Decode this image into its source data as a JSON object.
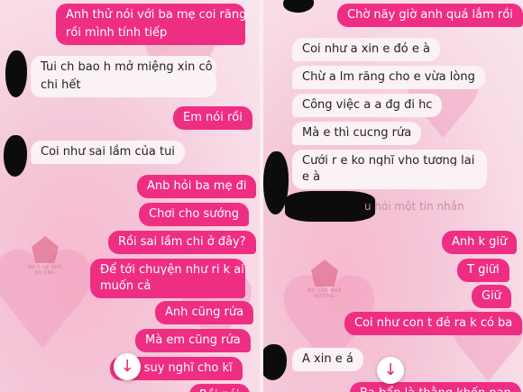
{
  "left": {
    "messages": [
      {
        "side": "out",
        "text": "Anh thử nói với ba mẹ coi răng"
      },
      {
        "side": "out",
        "text": "rồi mình tính tiếp"
      },
      {
        "side": "in",
        "text": "Tui ch bao h mở miệng xin cô"
      },
      {
        "side": "in",
        "text": "chi hết"
      },
      {
        "side": "out",
        "text": "Em nói rồi"
      },
      {
        "side": "in",
        "text": "Coi như sai lầm của tui"
      },
      {
        "side": "out",
        "text": "Anb hỏi ba mẹ đi"
      },
      {
        "side": "out",
        "text": "Chơi cho sướng"
      },
      {
        "side": "out",
        "text": "Rồi sai lầm chi ở đây?"
      },
      {
        "side": "out",
        "text": "Để tới chuyện như ri k ai"
      },
      {
        "side": "out",
        "text": "muốn cả"
      },
      {
        "side": "out",
        "text": "Anh cũng rứa"
      },
      {
        "side": "out",
        "text": "Mà em cũng rứa"
      },
      {
        "side": "out",
        "text": "là suy nghĩ cho kĩ"
      },
      {
        "side": "out",
        "text": "Rồi nói"
      }
    ],
    "watermark": "MẸ CON NHÀ ĐƯỜNG"
  },
  "right": {
    "messages": [
      {
        "side": "out",
        "text": "Chờ nãy giờ anh quá lắm rồi"
      },
      {
        "side": "in",
        "text": "Coi như a xin e đó e à"
      },
      {
        "side": "in",
        "text": "Chừ a lm răng cho e vừa lòng"
      },
      {
        "side": "in",
        "text": "Công việc a a đg đi hc"
      },
      {
        "side": "in",
        "text": "Mà e thì cucng rứa"
      },
      {
        "side": "in",
        "text": "Cưới r e ko nghĩ vho tương lai"
      },
      {
        "side": "in",
        "text": "e à"
      },
      {
        "side": "out",
        "text": "Anh k giữ"
      },
      {
        "side": "out",
        "text": "T giữi"
      },
      {
        "side": "out",
        "text": "Giữ"
      },
      {
        "side": "out",
        "text": "Coi như con t đẻ ra k có ba"
      },
      {
        "side": "in",
        "text": "A xin e á"
      },
      {
        "side": "out",
        "text": "Ba bẩn là thằng khốn nạn"
      }
    ],
    "reply_hint": "u hỏi một tin nhắn",
    "watermark": "MẸ CON NHÀ ĐƯỜNG"
  },
  "icons": {
    "scroll_down": "↓"
  }
}
